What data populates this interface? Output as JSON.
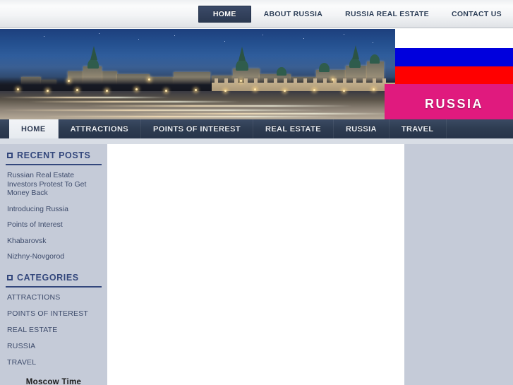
{
  "site": {
    "banner_title": "RUSSIA",
    "banner_image_alt": "moscow-kremlin-night-panorama"
  },
  "topnav": {
    "items": [
      {
        "label": "HOME",
        "active": true
      },
      {
        "label": "ABOUT RUSSIA",
        "active": false
      },
      {
        "label": "RUSSIA REAL ESTATE",
        "active": false
      },
      {
        "label": "CONTACT US",
        "active": false
      }
    ]
  },
  "mainnav": {
    "items": [
      {
        "label": "HOME",
        "active": true
      },
      {
        "label": "ATTRACTIONS",
        "active": false
      },
      {
        "label": "POINTS OF INTEREST",
        "active": false
      },
      {
        "label": "REAL ESTATE",
        "active": false
      },
      {
        "label": "RUSSIA",
        "active": false
      },
      {
        "label": "TRAVEL",
        "active": false
      }
    ]
  },
  "sidebar": {
    "recent_posts": {
      "title": "RECENT POSTS",
      "items": [
        {
          "label": "Russian Real Estate Investors Protest To Get Money Back"
        },
        {
          "label": "Introducing Russia"
        },
        {
          "label": "Points of Interest"
        },
        {
          "label": "Khabarovsk"
        },
        {
          "label": "Nizhny-Novgorod"
        }
      ]
    },
    "categories": {
      "title": "CATEGORIES",
      "items": [
        {
          "label": "ATTRACTIONS"
        },
        {
          "label": "POINTS OF INTEREST"
        },
        {
          "label": "REAL ESTATE"
        },
        {
          "label": "RUSSIA"
        },
        {
          "label": "TRAVEL"
        }
      ]
    },
    "moscow_time": {
      "title": "Moscow Time"
    }
  },
  "colors": {
    "topnav_active_bg": "#2b3951",
    "mainnav_bg": "#2e3c51",
    "mainnav_active_bg": "#eef1f5",
    "sidebar_bg": "#c5cbd8",
    "content_bg": "#ffffff",
    "heading_blue": "#33477c",
    "flag_white": "#ffffff",
    "flag_blue": "#0000dd",
    "flag_red": "#ff0000",
    "magenta_band": "#e01a7e"
  }
}
